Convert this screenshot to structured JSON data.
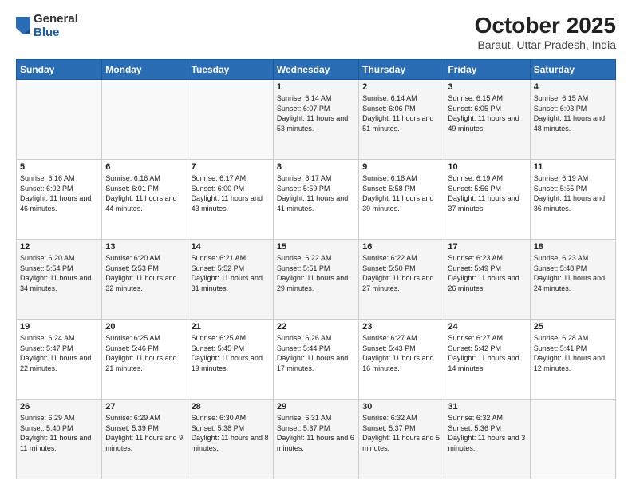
{
  "header": {
    "logo_general": "General",
    "logo_blue": "Blue",
    "title": "October 2025",
    "subtitle": "Baraut, Uttar Pradesh, India"
  },
  "weekdays": [
    "Sunday",
    "Monday",
    "Tuesday",
    "Wednesday",
    "Thursday",
    "Friday",
    "Saturday"
  ],
  "weeks": [
    [
      {
        "day": "",
        "sunrise": "",
        "sunset": "",
        "daylight": ""
      },
      {
        "day": "",
        "sunrise": "",
        "sunset": "",
        "daylight": ""
      },
      {
        "day": "",
        "sunrise": "",
        "sunset": "",
        "daylight": ""
      },
      {
        "day": "1",
        "sunrise": "Sunrise: 6:14 AM",
        "sunset": "Sunset: 6:07 PM",
        "daylight": "Daylight: 11 hours and 53 minutes."
      },
      {
        "day": "2",
        "sunrise": "Sunrise: 6:14 AM",
        "sunset": "Sunset: 6:06 PM",
        "daylight": "Daylight: 11 hours and 51 minutes."
      },
      {
        "day": "3",
        "sunrise": "Sunrise: 6:15 AM",
        "sunset": "Sunset: 6:05 PM",
        "daylight": "Daylight: 11 hours and 49 minutes."
      },
      {
        "day": "4",
        "sunrise": "Sunrise: 6:15 AM",
        "sunset": "Sunset: 6:03 PM",
        "daylight": "Daylight: 11 hours and 48 minutes."
      }
    ],
    [
      {
        "day": "5",
        "sunrise": "Sunrise: 6:16 AM",
        "sunset": "Sunset: 6:02 PM",
        "daylight": "Daylight: 11 hours and 46 minutes."
      },
      {
        "day": "6",
        "sunrise": "Sunrise: 6:16 AM",
        "sunset": "Sunset: 6:01 PM",
        "daylight": "Daylight: 11 hours and 44 minutes."
      },
      {
        "day": "7",
        "sunrise": "Sunrise: 6:17 AM",
        "sunset": "Sunset: 6:00 PM",
        "daylight": "Daylight: 11 hours and 43 minutes."
      },
      {
        "day": "8",
        "sunrise": "Sunrise: 6:17 AM",
        "sunset": "Sunset: 5:59 PM",
        "daylight": "Daylight: 11 hours and 41 minutes."
      },
      {
        "day": "9",
        "sunrise": "Sunrise: 6:18 AM",
        "sunset": "Sunset: 5:58 PM",
        "daylight": "Daylight: 11 hours and 39 minutes."
      },
      {
        "day": "10",
        "sunrise": "Sunrise: 6:19 AM",
        "sunset": "Sunset: 5:56 PM",
        "daylight": "Daylight: 11 hours and 37 minutes."
      },
      {
        "day": "11",
        "sunrise": "Sunrise: 6:19 AM",
        "sunset": "Sunset: 5:55 PM",
        "daylight": "Daylight: 11 hours and 36 minutes."
      }
    ],
    [
      {
        "day": "12",
        "sunrise": "Sunrise: 6:20 AM",
        "sunset": "Sunset: 5:54 PM",
        "daylight": "Daylight: 11 hours and 34 minutes."
      },
      {
        "day": "13",
        "sunrise": "Sunrise: 6:20 AM",
        "sunset": "Sunset: 5:53 PM",
        "daylight": "Daylight: 11 hours and 32 minutes."
      },
      {
        "day": "14",
        "sunrise": "Sunrise: 6:21 AM",
        "sunset": "Sunset: 5:52 PM",
        "daylight": "Daylight: 11 hours and 31 minutes."
      },
      {
        "day": "15",
        "sunrise": "Sunrise: 6:22 AM",
        "sunset": "Sunset: 5:51 PM",
        "daylight": "Daylight: 11 hours and 29 minutes."
      },
      {
        "day": "16",
        "sunrise": "Sunrise: 6:22 AM",
        "sunset": "Sunset: 5:50 PM",
        "daylight": "Daylight: 11 hours and 27 minutes."
      },
      {
        "day": "17",
        "sunrise": "Sunrise: 6:23 AM",
        "sunset": "Sunset: 5:49 PM",
        "daylight": "Daylight: 11 hours and 26 minutes."
      },
      {
        "day": "18",
        "sunrise": "Sunrise: 6:23 AM",
        "sunset": "Sunset: 5:48 PM",
        "daylight": "Daylight: 11 hours and 24 minutes."
      }
    ],
    [
      {
        "day": "19",
        "sunrise": "Sunrise: 6:24 AM",
        "sunset": "Sunset: 5:47 PM",
        "daylight": "Daylight: 11 hours and 22 minutes."
      },
      {
        "day": "20",
        "sunrise": "Sunrise: 6:25 AM",
        "sunset": "Sunset: 5:46 PM",
        "daylight": "Daylight: 11 hours and 21 minutes."
      },
      {
        "day": "21",
        "sunrise": "Sunrise: 6:25 AM",
        "sunset": "Sunset: 5:45 PM",
        "daylight": "Daylight: 11 hours and 19 minutes."
      },
      {
        "day": "22",
        "sunrise": "Sunrise: 6:26 AM",
        "sunset": "Sunset: 5:44 PM",
        "daylight": "Daylight: 11 hours and 17 minutes."
      },
      {
        "day": "23",
        "sunrise": "Sunrise: 6:27 AM",
        "sunset": "Sunset: 5:43 PM",
        "daylight": "Daylight: 11 hours and 16 minutes."
      },
      {
        "day": "24",
        "sunrise": "Sunrise: 6:27 AM",
        "sunset": "Sunset: 5:42 PM",
        "daylight": "Daylight: 11 hours and 14 minutes."
      },
      {
        "day": "25",
        "sunrise": "Sunrise: 6:28 AM",
        "sunset": "Sunset: 5:41 PM",
        "daylight": "Daylight: 11 hours and 12 minutes."
      }
    ],
    [
      {
        "day": "26",
        "sunrise": "Sunrise: 6:29 AM",
        "sunset": "Sunset: 5:40 PM",
        "daylight": "Daylight: 11 hours and 11 minutes."
      },
      {
        "day": "27",
        "sunrise": "Sunrise: 6:29 AM",
        "sunset": "Sunset: 5:39 PM",
        "daylight": "Daylight: 11 hours and 9 minutes."
      },
      {
        "day": "28",
        "sunrise": "Sunrise: 6:30 AM",
        "sunset": "Sunset: 5:38 PM",
        "daylight": "Daylight: 11 hours and 8 minutes."
      },
      {
        "day": "29",
        "sunrise": "Sunrise: 6:31 AM",
        "sunset": "Sunset: 5:37 PM",
        "daylight": "Daylight: 11 hours and 6 minutes."
      },
      {
        "day": "30",
        "sunrise": "Sunrise: 6:32 AM",
        "sunset": "Sunset: 5:37 PM",
        "daylight": "Daylight: 11 hours and 5 minutes."
      },
      {
        "day": "31",
        "sunrise": "Sunrise: 6:32 AM",
        "sunset": "Sunset: 5:36 PM",
        "daylight": "Daylight: 11 hours and 3 minutes."
      },
      {
        "day": "",
        "sunrise": "",
        "sunset": "",
        "daylight": ""
      }
    ]
  ]
}
